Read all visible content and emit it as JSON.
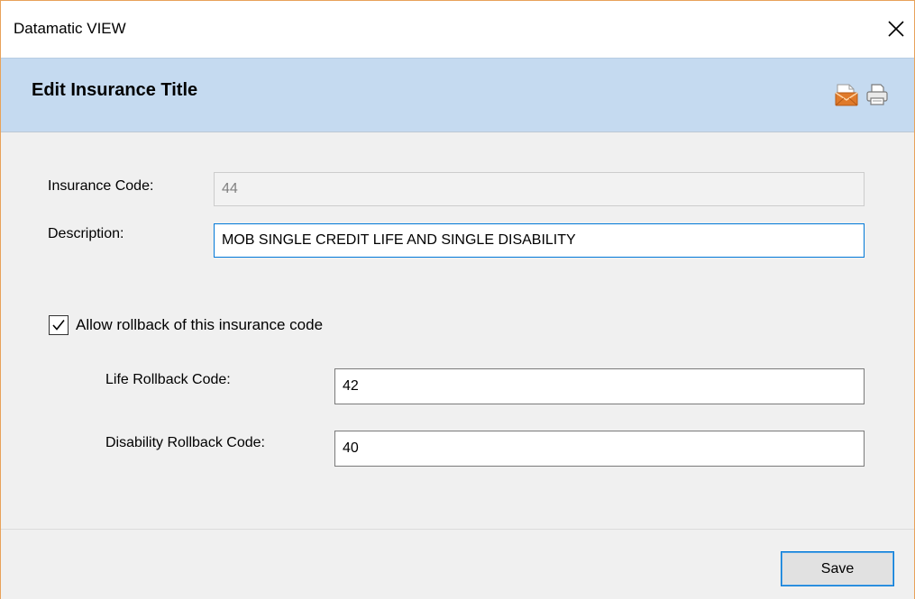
{
  "window": {
    "title": "Datamatic VIEW"
  },
  "header": {
    "title": "Edit Insurance Title",
    "icons": [
      "email-icon",
      "print-icon"
    ]
  },
  "form": {
    "insurance_code": {
      "label": "Insurance Code:",
      "value": "44",
      "disabled": true
    },
    "description": {
      "label": "Description:",
      "value": "MOB SINGLE CREDIT LIFE AND SINGLE DISABILITY"
    },
    "allow_rollback": {
      "label": "Allow rollback of this insurance code",
      "checked": true
    },
    "life_rollback_code": {
      "label": "Life Rollback Code:",
      "value": "42"
    },
    "disability_rollback_code": {
      "label": "Disability Rollback Code:",
      "value": "40"
    }
  },
  "footer": {
    "save_label": "Save"
  },
  "colors": {
    "header_band": "#c5daf0",
    "window_border": "#e8a25a",
    "focus_border": "#0078d7",
    "content_bg": "#f0f0f0"
  }
}
